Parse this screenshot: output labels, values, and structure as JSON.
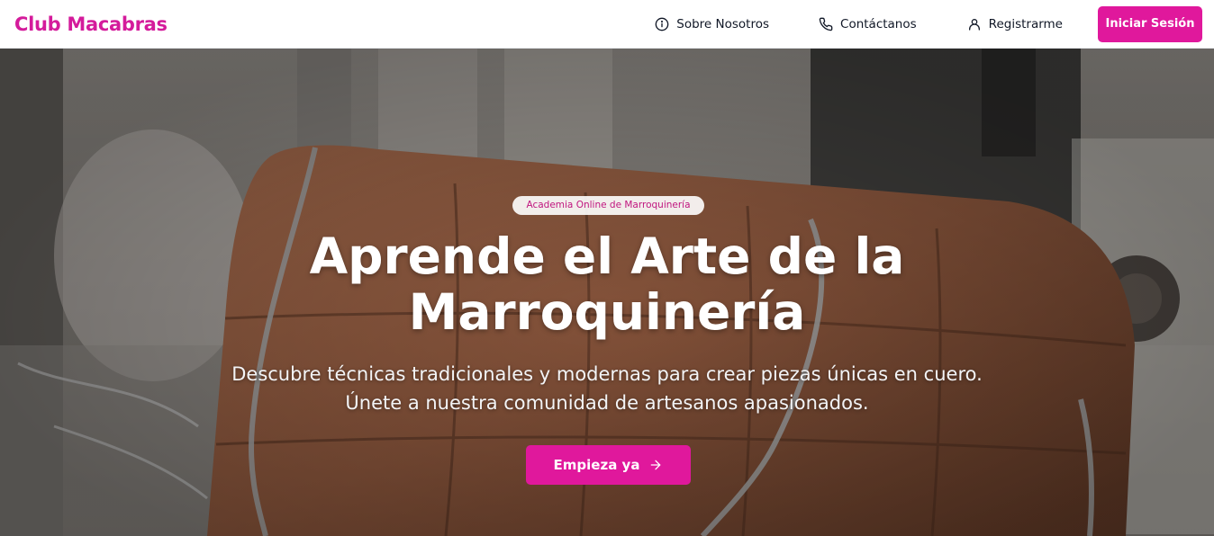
{
  "header": {
    "logo": "Club Macabras",
    "nav": {
      "about": "Sobre Nosotros",
      "contact": "Contáctanos",
      "register": "Registrarme"
    },
    "login_button": "Iniciar Sesión"
  },
  "hero": {
    "badge": "Academia Online de Marroquinería",
    "title": "Aprende el Arte de la Marroquinería",
    "subtitle": "Descubre técnicas tradicionales y modernas para crear piezas únicas en cuero. Únete a nuestra comunidad de artesanos apasionados.",
    "cta_label": "Empieza ya"
  },
  "icons": {
    "about": "info-icon",
    "contact": "phone-icon",
    "register": "user-icon",
    "cta": "arrow-right-icon"
  },
  "colors": {
    "brand": "#d41b9b",
    "button": "#e0189c",
    "header_bg": "#ffffff",
    "hero_text": "#ffffff"
  }
}
